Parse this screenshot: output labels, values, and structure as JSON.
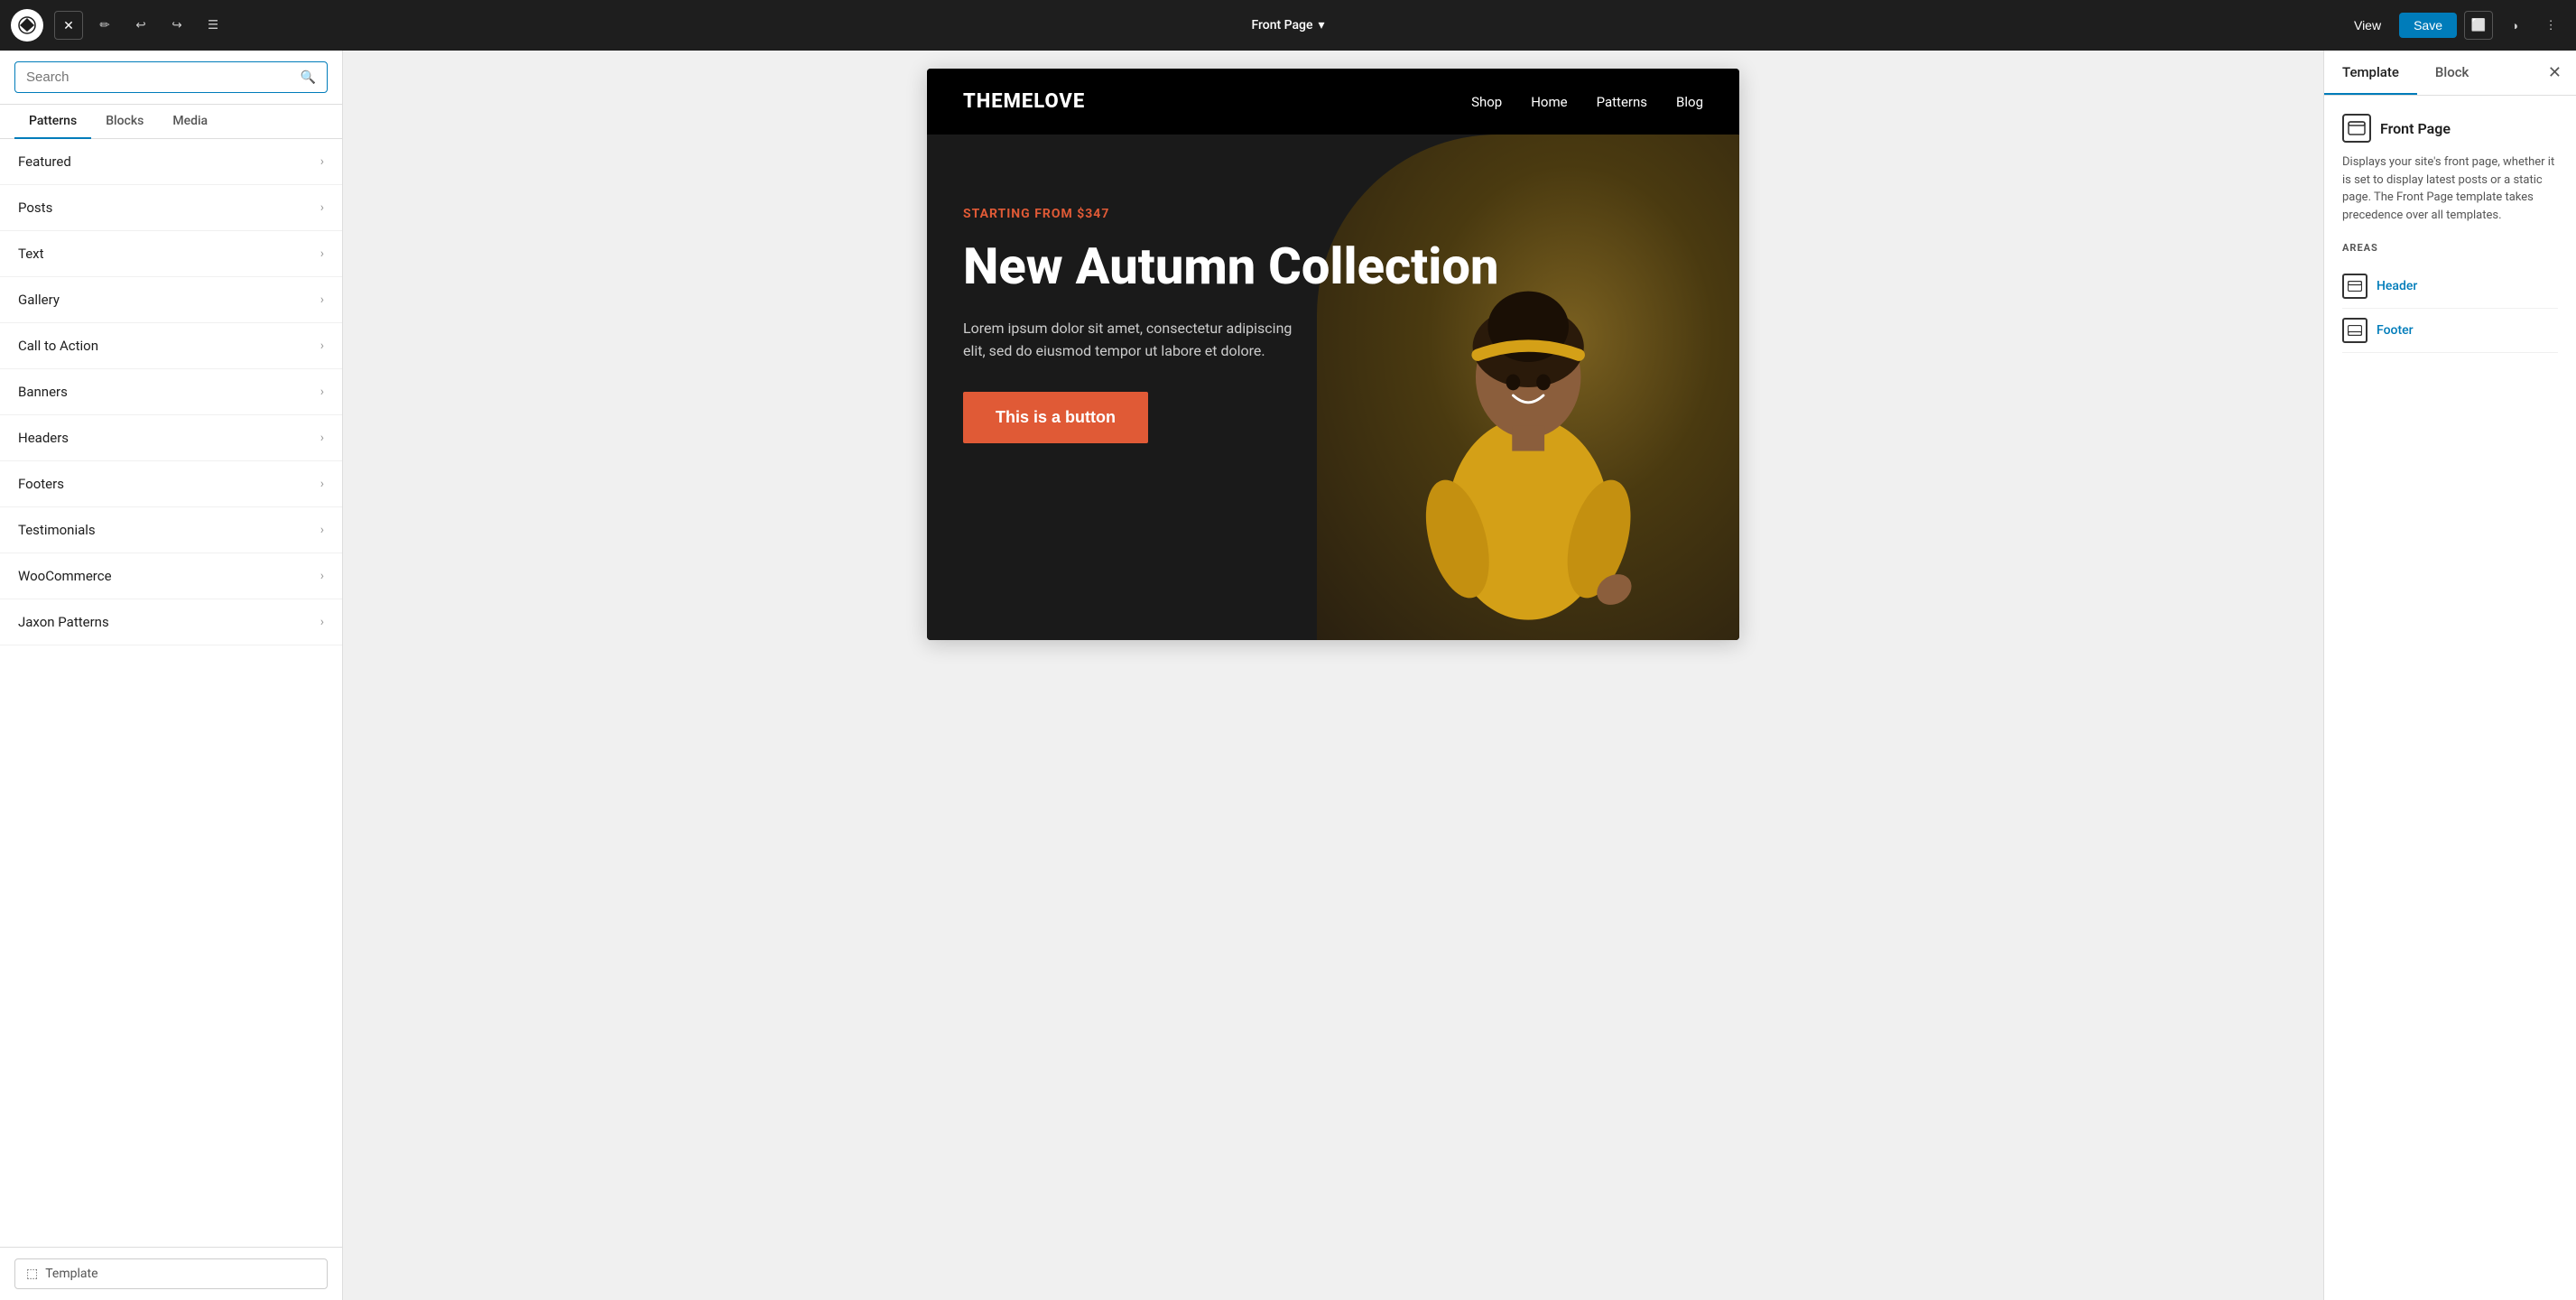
{
  "toolbar": {
    "close_label": "✕",
    "pen_icon": "✏",
    "undo_icon": "↩",
    "redo_icon": "↪",
    "list_icon": "☰",
    "page_title": "Front Page",
    "chevron_icon": "▾",
    "view_label": "View",
    "save_label": "Save",
    "square_icon": "⬜",
    "circle_icon": "◑",
    "more_icon": "⋮"
  },
  "left_sidebar": {
    "search_placeholder": "Search",
    "tabs": [
      {
        "id": "patterns",
        "label": "Patterns",
        "active": true
      },
      {
        "id": "blocks",
        "label": "Blocks",
        "active": false
      },
      {
        "id": "media",
        "label": "Media",
        "active": false
      }
    ],
    "patterns": [
      {
        "id": "featured",
        "label": "Featured"
      },
      {
        "id": "posts",
        "label": "Posts"
      },
      {
        "id": "text",
        "label": "Text"
      },
      {
        "id": "gallery",
        "label": "Gallery"
      },
      {
        "id": "call-to-action",
        "label": "Call to Action"
      },
      {
        "id": "banners",
        "label": "Banners"
      },
      {
        "id": "headers",
        "label": "Headers"
      },
      {
        "id": "footers",
        "label": "Footers"
      },
      {
        "id": "testimonials",
        "label": "Testimonials"
      },
      {
        "id": "woocommerce",
        "label": "WooCommerce"
      },
      {
        "id": "jaxon-patterns",
        "label": "Jaxon Patterns"
      }
    ],
    "footer_label": "Template"
  },
  "canvas": {
    "site_logo": "THEMELOVE",
    "nav_links": [
      "Shop",
      "Home",
      "Patterns",
      "Blog"
    ],
    "hero_tag": "STARTING FROM $347",
    "hero_title": "New Autumn Collection",
    "hero_desc": "Lorem ipsum dolor sit amet, consectetur adipiscing elit, sed do eiusmod tempor ut labore et dolore.",
    "hero_cta": "This is a button"
  },
  "right_sidebar": {
    "tabs": [
      {
        "id": "template",
        "label": "Template",
        "active": true
      },
      {
        "id": "block",
        "label": "Block",
        "active": false
      }
    ],
    "close_icon": "✕",
    "template": {
      "name": "Front Page",
      "description": "Displays your site's front page, whether it is set to display latest posts or a static page. The Front Page template takes precedence over all templates.",
      "areas_label": "AREAS",
      "areas": [
        {
          "id": "header",
          "label": "Header"
        },
        {
          "id": "footer",
          "label": "Footer"
        }
      ]
    }
  }
}
